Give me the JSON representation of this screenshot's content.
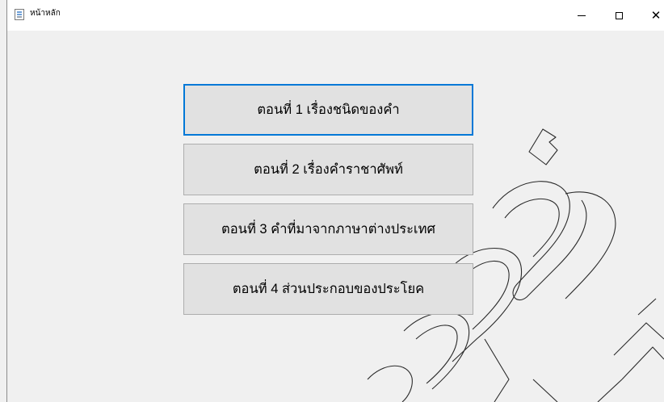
{
  "window": {
    "title": "หน้าหลัก"
  },
  "buttons": [
    {
      "label": "ตอนที่ 1 เรื่องชนิดของคำ"
    },
    {
      "label": "ตอนที่ 2 เรื่องคำราชาศัพท์"
    },
    {
      "label": "ตอนที่ 3 คำที่มาจากภาษาต่างประเทศ"
    },
    {
      "label": "ตอนที่ 4 ส่วนประกอบของประโยค"
    }
  ],
  "icons": {
    "app": "document-icon",
    "minimize": "minimize-icon",
    "maximize": "maximize-icon",
    "close": "close-icon"
  },
  "colors": {
    "focus_border": "#0078d7",
    "button_bg": "#e1e1e1",
    "window_bg": "#f0f0f0"
  }
}
